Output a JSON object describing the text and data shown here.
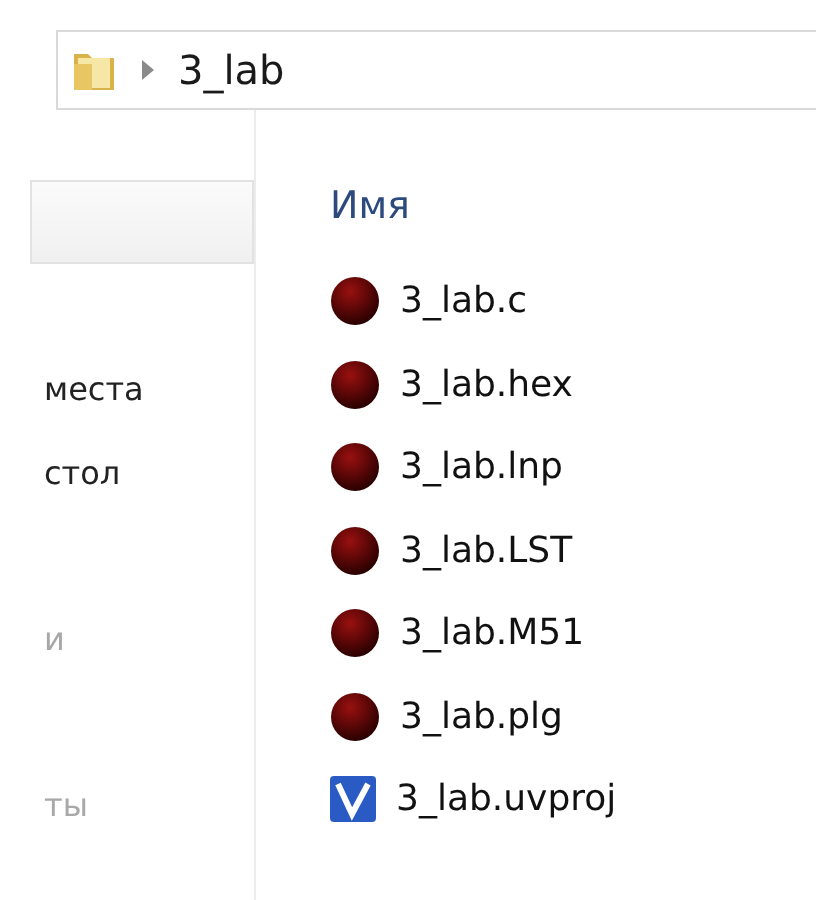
{
  "address_bar": {
    "path": "3_lab"
  },
  "sidebar": {
    "items": [
      {
        "label": "места",
        "dimmed": false
      },
      {
        "label": "стол",
        "dimmed": false
      },
      {
        "label": "и",
        "dimmed": true
      },
      {
        "label": "ты",
        "dimmed": true
      }
    ]
  },
  "file_list": {
    "column_header": "Имя",
    "files": [
      {
        "name": "3_lab.c",
        "kind": "ball"
      },
      {
        "name": "3_lab.hex",
        "kind": "ball"
      },
      {
        "name": "3_lab.lnp",
        "kind": "ball"
      },
      {
        "name": "3_lab.LST",
        "kind": "ball"
      },
      {
        "name": "3_lab.M51",
        "kind": "ball"
      },
      {
        "name": "3_lab.plg",
        "kind": "ball"
      },
      {
        "name": "3_lab.uvproj",
        "kind": "project"
      }
    ]
  }
}
